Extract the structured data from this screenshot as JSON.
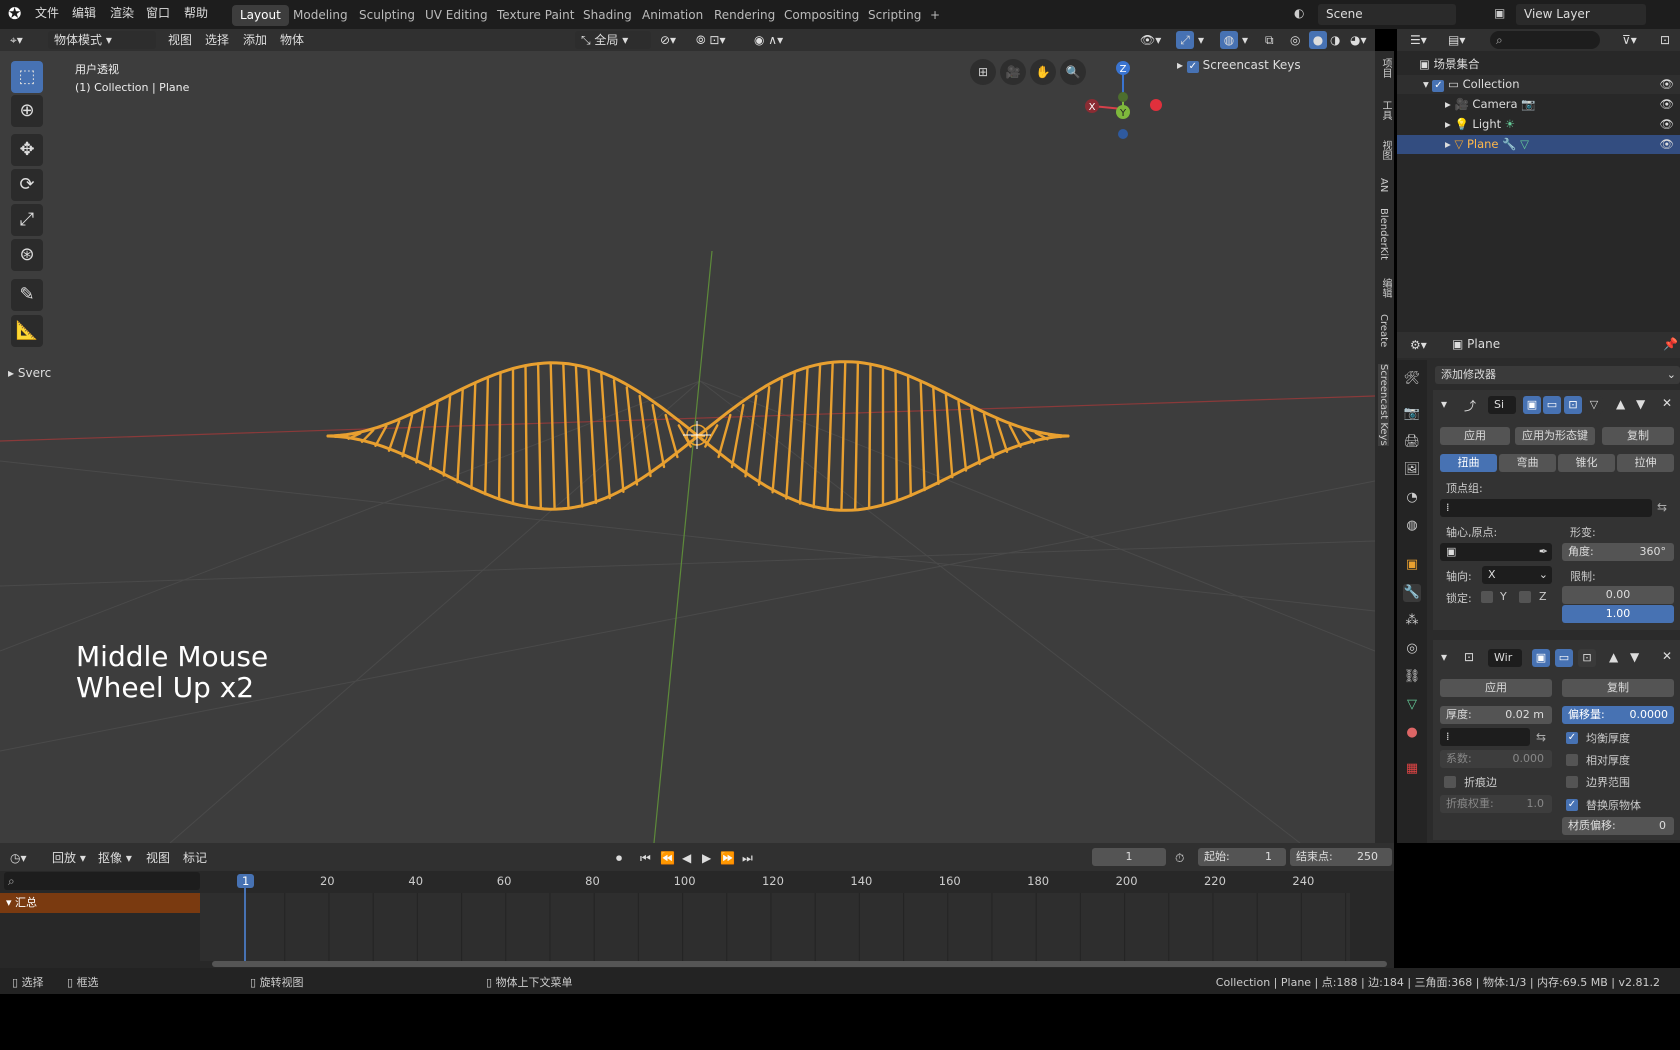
{
  "topbar": {
    "menus": [
      "文件",
      "编辑",
      "渲染",
      "窗口",
      "帮助"
    ],
    "workspaces": [
      "Layout",
      "Modeling",
      "Sculpting",
      "UV Editing",
      "Texture Paint",
      "Shading",
      "Animation",
      "Rendering",
      "Compositing",
      "Scripting"
    ],
    "active_workspace": "Layout",
    "add_tab": "+",
    "scene": "Scene",
    "view_layer": "View Layer"
  },
  "viewport_header": {
    "mode": "物体模式",
    "menus": [
      "视图",
      "选择",
      "添加",
      "物体"
    ],
    "transform_orientation": "全局"
  },
  "viewport": {
    "view_name": "用户透视",
    "collection_info": "(1) Collection | Plane",
    "sverchok_label": "Sverc",
    "screencast_keys_label": "Screencast Keys",
    "screencast_text_line1": "Middle Mouse",
    "screencast_text_line2": "Wheel Up x2",
    "gizmo": {
      "x": "X",
      "y": "Y",
      "z": "Z"
    }
  },
  "sidebar_tabs": [
    "项目",
    "工具",
    "视图",
    "AN",
    "BlenderKit",
    "编辑",
    "Create",
    "Screencast Keys"
  ],
  "outliner": {
    "root": "场景集合",
    "collection": "Collection",
    "items": [
      "Camera",
      "Light",
      "Plane"
    ]
  },
  "properties": {
    "object_name": "Plane",
    "add_modifier": "添加修改器",
    "simple_deform": {
      "name": "Si",
      "apply": "应用",
      "apply_as_shapekey": "应用为形态键",
      "copy": "复制",
      "methods": [
        "扭曲",
        "弯曲",
        "锥化",
        "拉伸"
      ],
      "active_method": "扭曲",
      "vertex_group": "顶点组:",
      "origin_label": "轴心,原点:",
      "deform_label": "形变:",
      "angle_label": "角度:",
      "angle_value": "360°",
      "axis_label": "轴向:",
      "axis_value": "X",
      "limit_label": "限制:",
      "limit_min": "0.00",
      "limit_max": "1.00",
      "lock_label": "锁定:",
      "lock_y": "Y",
      "lock_z": "Z"
    },
    "wireframe": {
      "name": "Wir",
      "apply": "应用",
      "copy": "复制",
      "thickness_label": "厚度:",
      "thickness_value": "0.02 m",
      "offset_label": "偏移量:",
      "offset_value": "0.0000",
      "even_thickness": "均衡厚度",
      "relative_thickness": "相对厚度",
      "factor_label": "系数:",
      "factor_value": "0.000",
      "boundary": "边界范围",
      "crease_edges": "折痕边",
      "replace_original": "替换原物体",
      "crease_weight_label": "折痕权重:",
      "crease_weight_value": "1.0",
      "material_offset_label": "材质偏移:",
      "material_offset_value": "0"
    }
  },
  "timeline": {
    "menus": [
      "回放",
      "抠像",
      "视图",
      "标记"
    ],
    "current_frame": "1",
    "start_label": "起始:",
    "start_value": "1",
    "end_label": "结束点:",
    "end_value": "250",
    "frame_ticks": [
      "1",
      "20",
      "40",
      "60",
      "80",
      "100",
      "120",
      "140",
      "160",
      "180",
      "200",
      "220",
      "240"
    ],
    "summary_label": "汇总"
  },
  "statusbar": {
    "select": "选择",
    "box_select": "框选",
    "rotate_view": "旋转视图",
    "context_menu": "物体上下文菜单",
    "stats": "Collection | Plane | 点:188 | 边:184 | 三角面:368 | 物体:1/3 | 内存:69.5 MB | v2.81.2"
  },
  "colors": {
    "accent": "#4772b3",
    "selection": "#e8a030",
    "axis_x": "#d6404a",
    "axis_y": "#7eb83c",
    "axis_z": "#3a74d0"
  }
}
